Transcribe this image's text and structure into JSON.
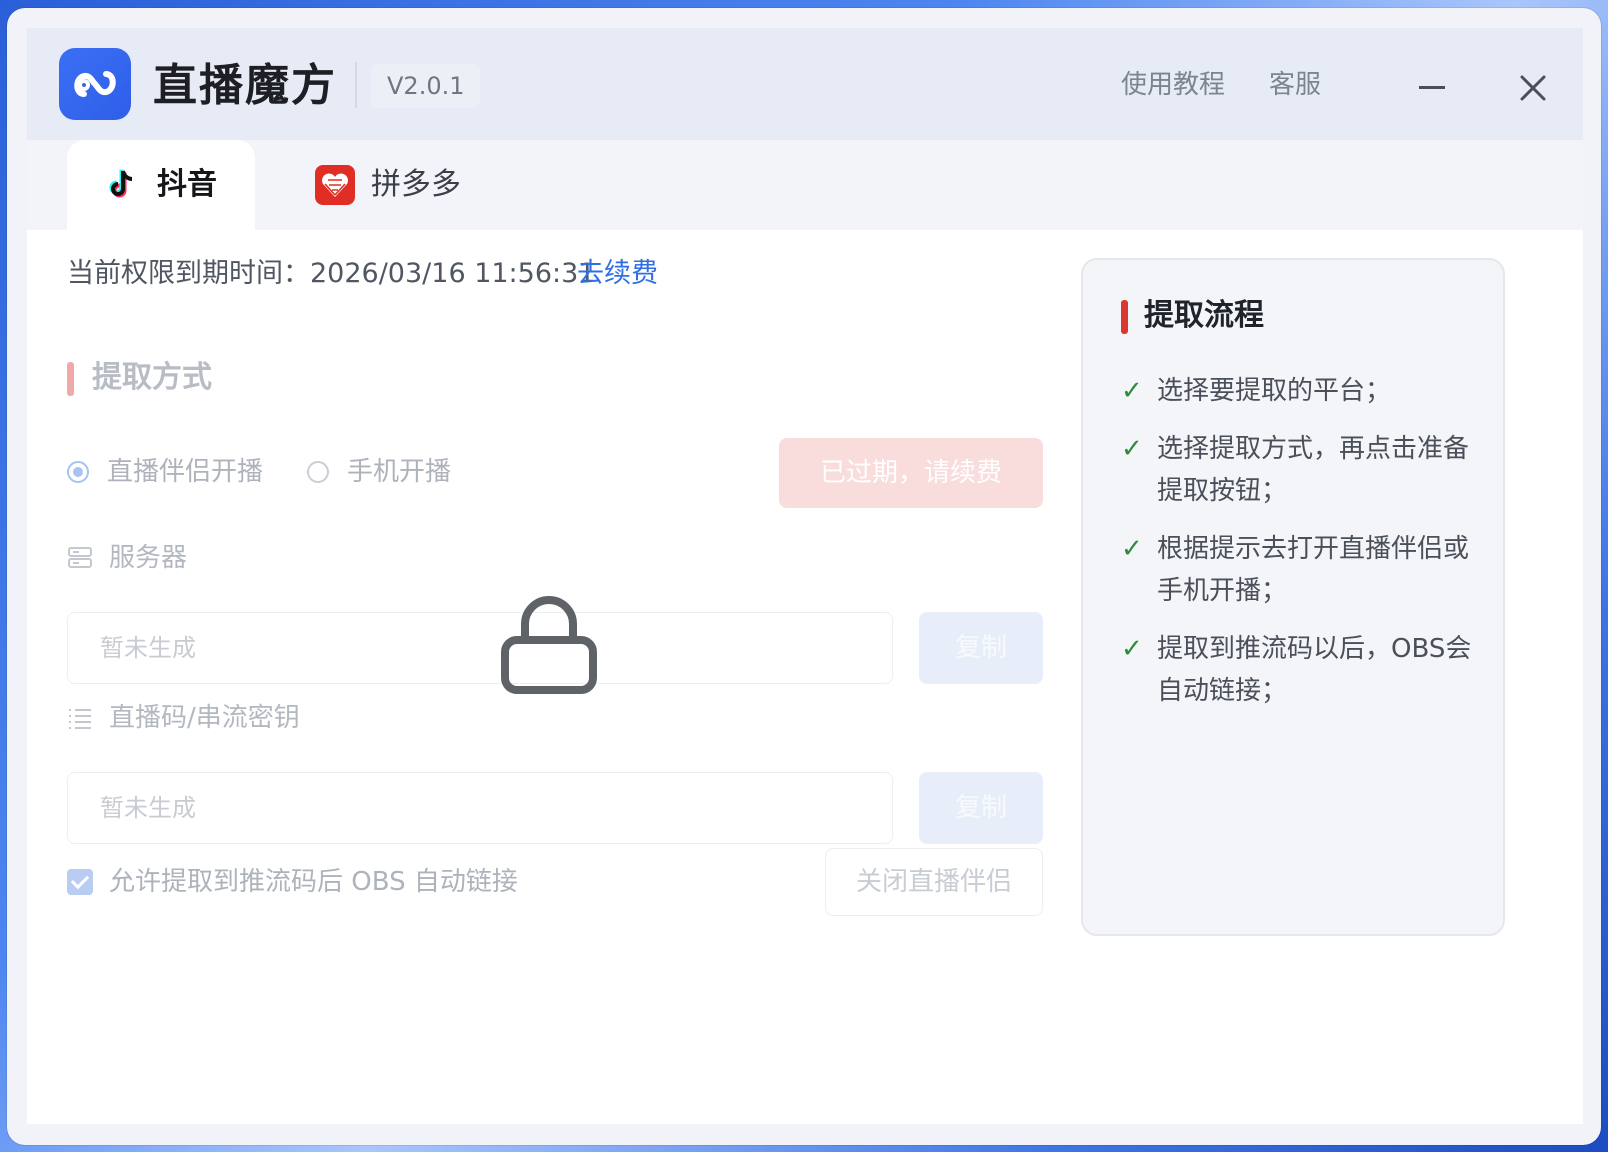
{
  "app": {
    "title": "直播魔方",
    "version": "V2.0.1",
    "links": {
      "tutorial": "使用教程",
      "support": "客服"
    }
  },
  "tabs": [
    {
      "label": "抖音",
      "icon": "douyin-icon",
      "active": true
    },
    {
      "label": "拼多多",
      "icon": "pinduoduo-icon",
      "active": false
    }
  ],
  "license": {
    "label": "当前权限到期时间：",
    "expiry": "2026/03/16 11:56:31",
    "renew_link": "去续费"
  },
  "extract": {
    "section_title": "提取方式",
    "options": [
      {
        "label": "直播伴侣开播",
        "selected": true
      },
      {
        "label": "手机开播",
        "selected": false
      }
    ],
    "action_button": "已过期，请续费",
    "server": {
      "label": "服务器",
      "placeholder": "暂未生成",
      "copy": "复制"
    },
    "stream_key": {
      "label": "直播码/串流密钥",
      "placeholder": "暂未生成",
      "copy": "复制"
    },
    "auto_link": {
      "label": "允许提取到推流码后 OBS 自动链接",
      "checked": true
    },
    "close_partner_button": "关闭直播伴侣",
    "locked": true
  },
  "process": {
    "title": "提取流程",
    "steps": [
      "选择要提取的平台；",
      "选择提取方式，再点击准备提取按钮；",
      "根据提示去打开直播伴侣或手机开播；",
      "提取到推流码以后，OBS会自动链接；"
    ]
  },
  "colors": {
    "accent_blue": "#2f6fe6",
    "danger_red": "#d9372f",
    "check_green": "#2e8b3a"
  }
}
